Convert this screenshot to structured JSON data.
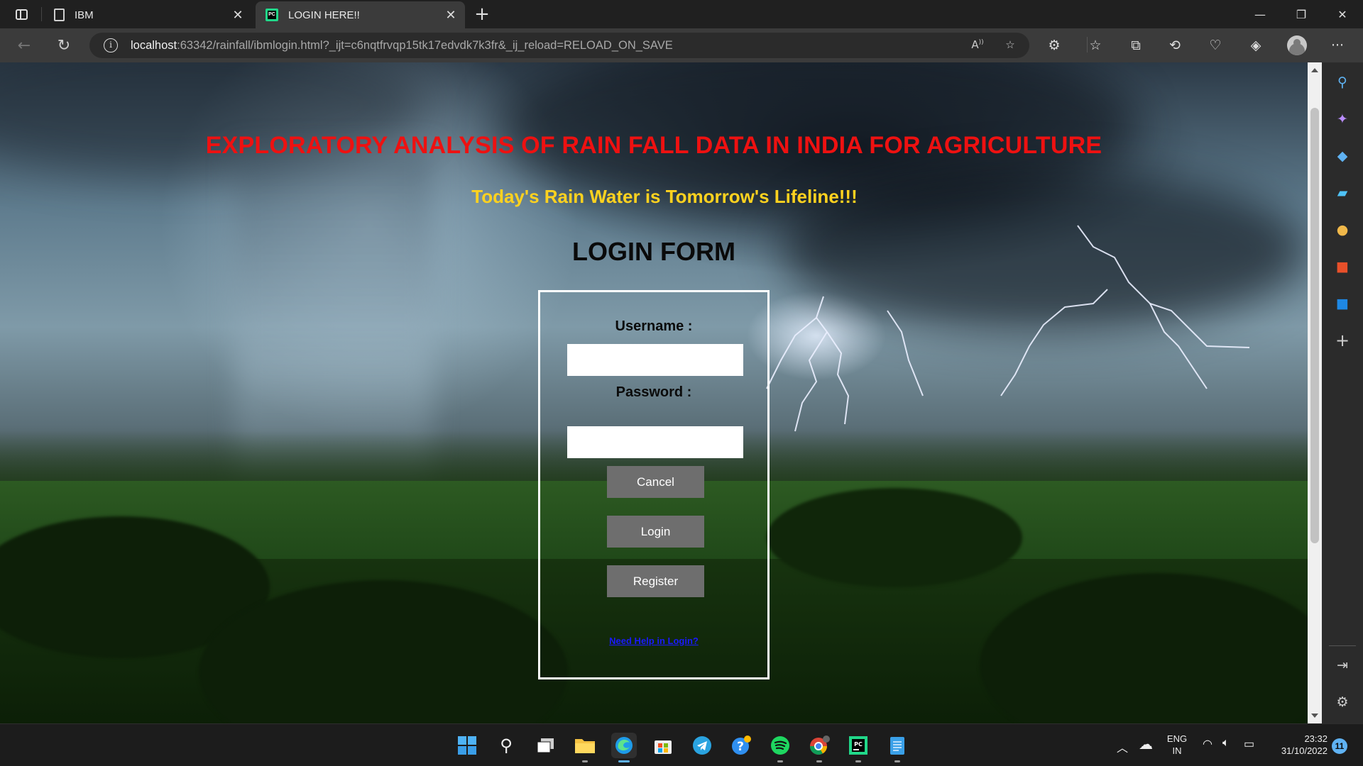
{
  "browser": {
    "tabs": [
      {
        "title": "IBM",
        "icon": "document-icon",
        "active": false
      },
      {
        "title": "LOGIN HERE!!",
        "icon": "pycharm-icon",
        "active": true
      }
    ],
    "address": {
      "host": "localhost",
      "rest": ":63342/rainfall/ibmlogin.html?_ijt=c6nqtfrvqp15tk17edvdk7k3fr&_ij_reload=RELOAD_ON_SAVE"
    },
    "colors": {
      "chrome_dark": "#202020",
      "chrome_mid": "#3b3b3b",
      "url_box": "#2b2b2b"
    }
  },
  "page": {
    "title": "EXPLORATORY ANALYSIS OF RAIN FALL DATA IN INDIA FOR AGRICULTURE",
    "tagline": "Today's Rain Water is Tomorrow's Lifeline!!!",
    "form_heading": "LOGIN FORM",
    "form": {
      "username_label": "Username :",
      "username_value": "",
      "password_label": "Password :",
      "password_value": "",
      "cancel_label": "Cancel",
      "login_label": "Login",
      "register_label": "Register",
      "help_link": "Need Help in Login?"
    },
    "colors": {
      "title": "#ee1111",
      "tagline": "#ffd21f",
      "button": "#6e6e6e",
      "link": "#1a1aff"
    }
  },
  "taskbar": {
    "language": "ENG",
    "region": "IN",
    "time": "23:32",
    "date": "31/10/2022",
    "notifications": "11"
  }
}
